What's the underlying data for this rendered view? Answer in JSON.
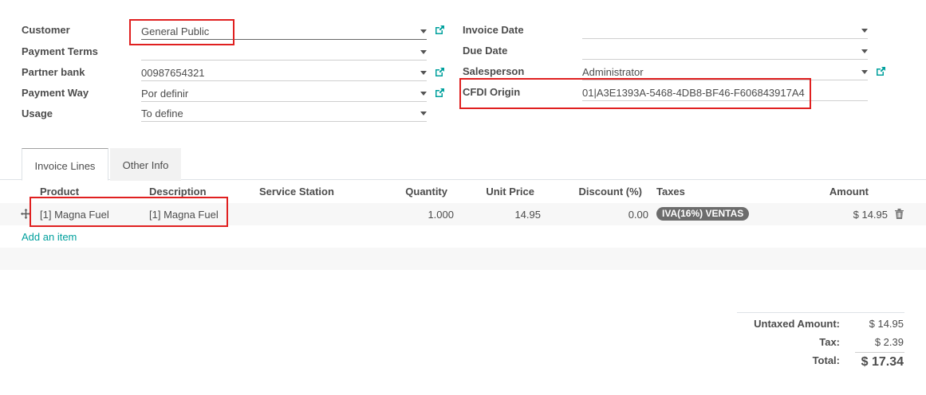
{
  "form": {
    "left": [
      {
        "label": "Customer",
        "value": "General Public"
      },
      {
        "label": "Payment Terms",
        "value": ""
      },
      {
        "label": "Partner bank",
        "value": "00987654321"
      },
      {
        "label": "Payment Way",
        "value": "Por definir"
      },
      {
        "label": "Usage",
        "value": "To define"
      }
    ],
    "right": [
      {
        "label": "Invoice Date",
        "value": ""
      },
      {
        "label": "Due Date",
        "value": ""
      },
      {
        "label": "Salesperson",
        "value": "Administrator"
      },
      {
        "label": "CFDI Origin",
        "value": "01|A3E1393A-5468-4DB8-BF46-F606843917A4"
      }
    ]
  },
  "tabs": [
    "Invoice Lines",
    "Other Info"
  ],
  "table": {
    "headers": [
      "Product",
      "Description",
      "Service Station",
      "Quantity",
      "Unit Price",
      "Discount (%)",
      "Taxes",
      "Amount"
    ],
    "rows": [
      {
        "product": "[1] Magna Fuel",
        "description": "[1] Magna Fuel",
        "service_station": "",
        "quantity": "1.000",
        "unit_price": "14.95",
        "discount": "0.00",
        "tax_badge": "IVA(16%) VENTAS",
        "amount": "$ 14.95"
      }
    ],
    "add_item": "Add an item"
  },
  "totals": {
    "untaxed_label": "Untaxed Amount:",
    "untaxed_value": "$ 14.95",
    "tax_label": "Tax:",
    "tax_value": "$ 2.39",
    "total_label": "Total:",
    "total_value": "$ 17.34"
  },
  "colors": {
    "accent": "#00a09d",
    "highlight": "#e02020",
    "badge": "#6c6c6c"
  }
}
